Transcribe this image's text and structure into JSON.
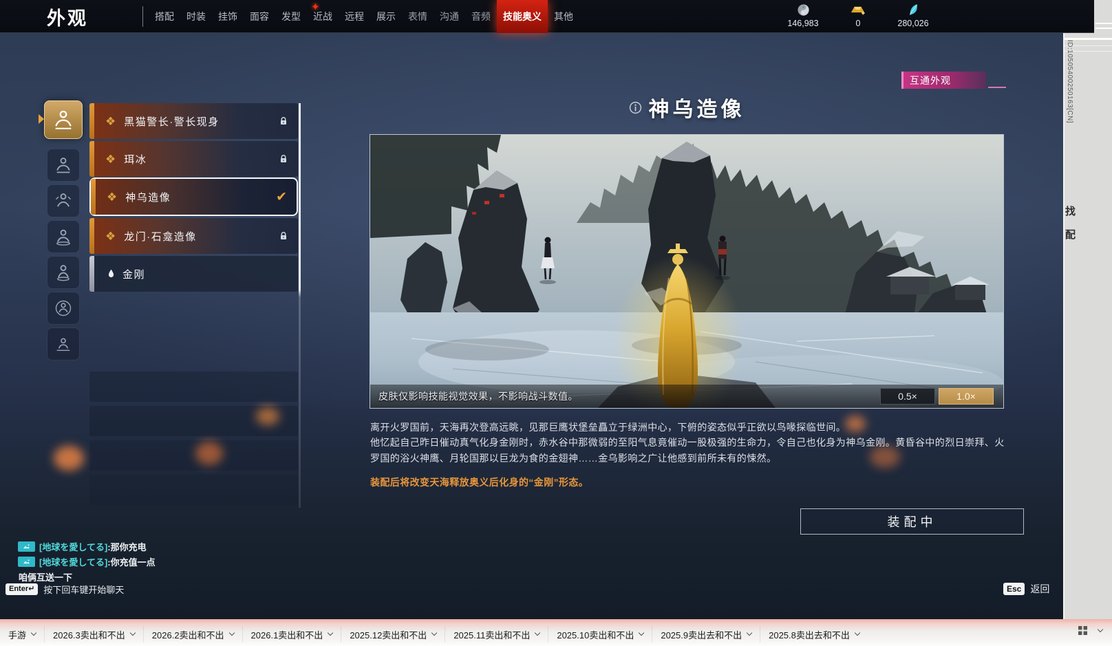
{
  "header": {
    "title": "外观",
    "tabs": [
      "搭配",
      "时装",
      "挂饰",
      "面容",
      "发型",
      "近战",
      "远程",
      "展示",
      "表情",
      "沟通",
      "音频",
      "技能奥义",
      "其他"
    ],
    "active_tab": "技能奥义",
    "currencies": [
      {
        "icon": "taichi-coin-icon",
        "value": "146,983"
      },
      {
        "icon": "gold-ingot-icon",
        "value": "0"
      },
      {
        "icon": "feather-icon",
        "value": "280,026"
      }
    ]
  },
  "interop_badge": "互通外观",
  "page": {
    "title": "神乌造像"
  },
  "list": {
    "items": [
      {
        "label": "黑猫警长·警长现身",
        "locked": true,
        "selected": false
      },
      {
        "label": "珥冰",
        "locked": true,
        "selected": false
      },
      {
        "label": "神乌造像",
        "locked": false,
        "selected": true,
        "equipped": true
      },
      {
        "label": "龙门·石龛造像",
        "locked": true,
        "selected": false
      },
      {
        "label": "金刚",
        "locked": false,
        "selected": false,
        "default": true
      }
    ]
  },
  "preview": {
    "notice": "皮肤仅影响技能视觉效果，不影响战斗数值。",
    "scale_options": [
      {
        "label": "0.5×",
        "selected": false
      },
      {
        "label": "1.0×",
        "selected": true
      }
    ]
  },
  "description": {
    "line1": "离开火罗国前，天海再次登高远眺，见那巨鹰状堡垒矗立于绿洲中心，下俯的姿态似乎正欲以鸟喙探临世间。",
    "line2": "他忆起自己昨日催动真气化身金刚时，赤水谷中那微弱的至阳气息竟催动一股极强的生命力，令自己也化身为神乌金刚。黄昏谷中的烈日崇拜、火罗国的浴火神鹰、月轮国那以巨龙为食的金翅神……金乌影响之广让他感到前所未有的悚然。",
    "warning": "装配后将改变天海释放奥义后化身的“金刚”形态。"
  },
  "equip_button": "装配中",
  "chat": {
    "messages": [
      {
        "name": "[地球を愛してる]",
        "text": ":那你充电"
      },
      {
        "name": "[地球を愛してる]",
        "text": ":你充值一点"
      },
      {
        "name": "",
        "text": "咱俩互送一下"
      }
    ],
    "prompt_key": "Enter↵",
    "prompt": "按下回车键开始聊天"
  },
  "footer": {
    "esc_key": "Esc",
    "back_label": "返回"
  },
  "right_strip": {
    "id_text": "ID:10505400250163[CN]",
    "char1": "找",
    "char2": "配"
  },
  "taskbar": {
    "items": [
      "手游",
      "2026.3卖出和不出",
      "2026.2卖出和不出",
      "2026.1卖出和不出",
      "2025.12卖出和不出",
      "2025.11卖出和不出",
      "2025.10卖出和不出",
      "2025.9卖出去和不出",
      "2025.8卖出去和不出"
    ]
  },
  "icons": {
    "diamond_glyph": "❖",
    "check_glyph": "✔",
    "sparkle_glyph": "✦",
    "drop_glyph": "◆"
  },
  "colors": {
    "accent_red": "#c01c0e",
    "badge_pink": "#c53584",
    "gold": "#dca23f",
    "warning_orange": "#e8953a",
    "chat_teal": "#4fd8da"
  }
}
